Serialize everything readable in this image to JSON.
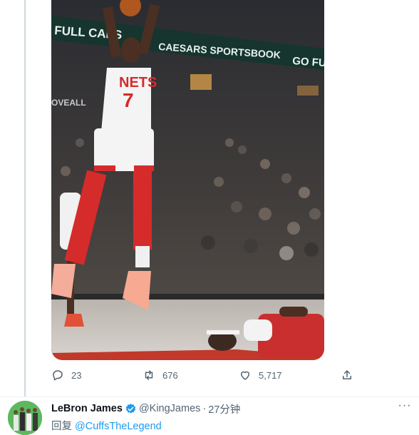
{
  "tweet": {
    "image": {
      "jersey_team": "NETS",
      "jersey_number": "7",
      "arena_banner_left": "FULL CAES",
      "arena_banner_mid": "CAESARS SPORTSBOOK",
      "arena_banner_right": "GO FUL",
      "side_sign": "OVEALL"
    },
    "actions": {
      "reply_count": "23",
      "retweet_count": "676",
      "like_count": "5,717"
    }
  },
  "reply": {
    "display_name": "LeBron James",
    "handle": "@KingJames",
    "separator": "·",
    "time": "27分钟",
    "reply_prefix": "回复",
    "reply_mention": "@CuffsTheLegend"
  },
  "colors": {
    "link": "#1d9bf0",
    "secondary_text": "#536471",
    "verified": "#1d9bf0",
    "jersey_red": "#d62b2b"
  },
  "icons": [
    "reply-icon",
    "retweet-icon",
    "like-icon",
    "share-icon",
    "verified-badge-icon",
    "more-icon"
  ]
}
